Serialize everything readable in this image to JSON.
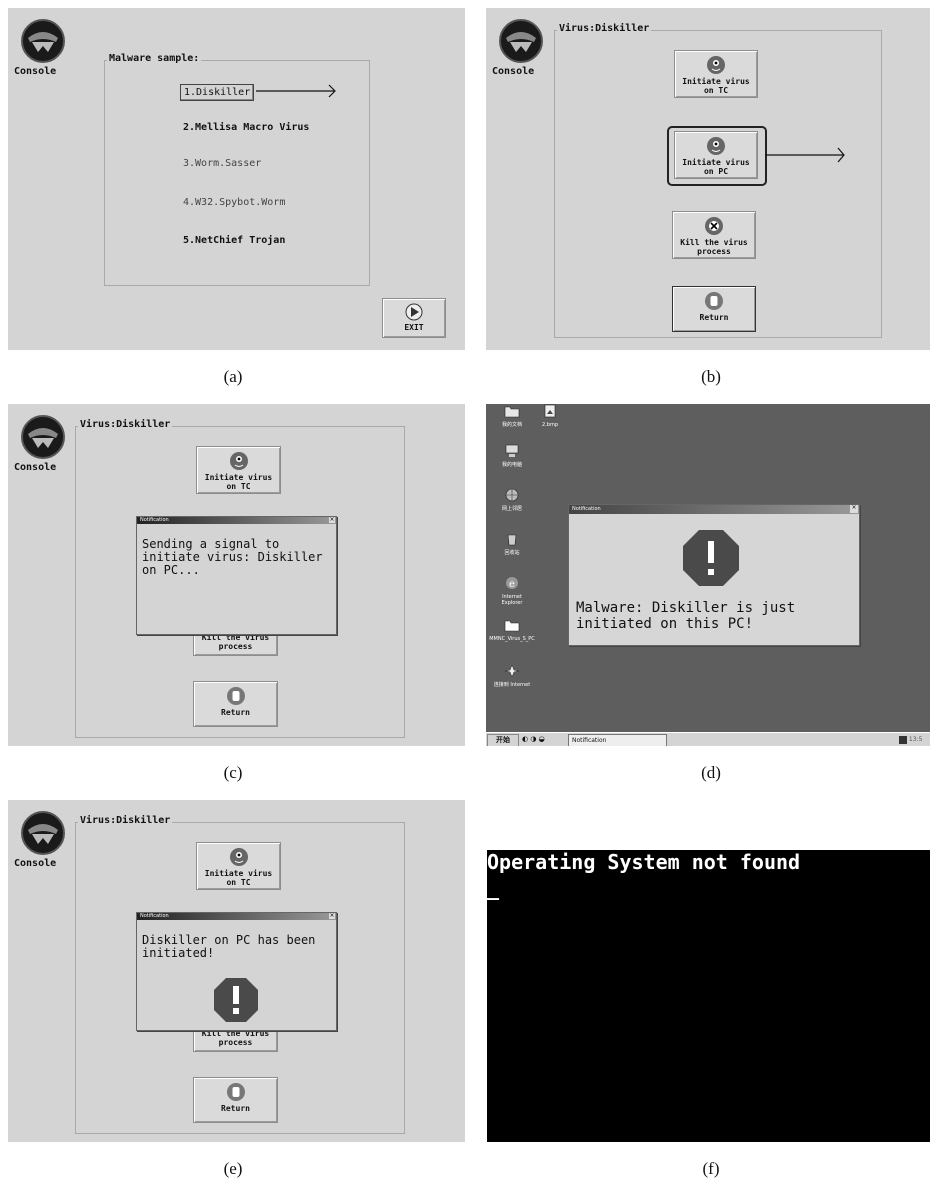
{
  "captions": [
    "(a)",
    "(b)",
    "(c)",
    "(d)",
    "(e)",
    "(f)"
  ],
  "console_label": "Console",
  "panel_a": {
    "group_title": "Malware sample:",
    "items": [
      "1.Diskiller",
      "2.Mellisa Macro Virus",
      "3.Worm.Sasser",
      "4.W32.Spybot.Worm",
      "5.NetChief Trojan"
    ],
    "exit_label": "EXIT"
  },
  "virus_panel": {
    "group_title": "Virus:Diskiller",
    "initiate_tc": [
      "Initiate virus",
      "on TC"
    ],
    "initiate_pc": [
      "Initiate virus",
      "on PC"
    ],
    "kill": [
      "Kill the virus",
      "process"
    ],
    "return_label": "Return"
  },
  "panel_c": {
    "dialog_title": "Notification",
    "message": [
      "Sending a signal to",
      "initiate virus: Diskiller",
      "on PC..."
    ]
  },
  "panel_d": {
    "desktop_icons": [
      "我的文档",
      "2.bmp",
      "我的电脑",
      "网上邻居",
      "回收站",
      "Internet Explorer",
      "MMNC_Virus_S_PC",
      "连接到 Internet"
    ],
    "dialog_title": "Notification",
    "message": [
      "Malware: Diskiller is just",
      "initiated on this PC!"
    ],
    "taskbar_start": "开始",
    "taskbar_task": "Notification",
    "tray_time": "13:5"
  },
  "panel_e": {
    "dialog_title": "Notification",
    "message": [
      "Diskiller on PC has been",
      "initiated!"
    ]
  },
  "panel_f": {
    "message": "Operating System not found",
    "cursor": "_"
  },
  "colors": {
    "panel_bg": "#d4d4d4",
    "desktop_bg": "#5e5e5e",
    "console_bg": "#000000"
  }
}
